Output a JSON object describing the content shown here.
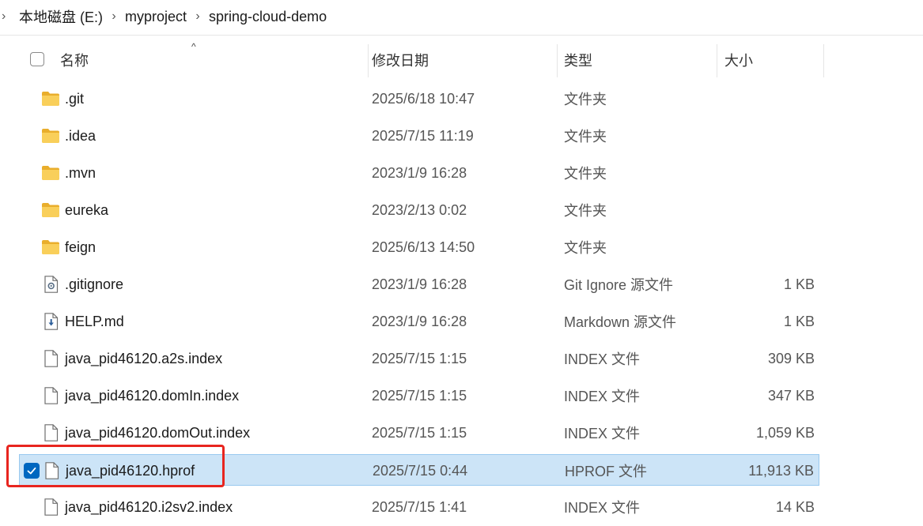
{
  "breadcrumb": {
    "items": [
      {
        "label": "本地磁盘 (E:)"
      },
      {
        "label": "myproject"
      },
      {
        "label": "spring-cloud-demo"
      }
    ]
  },
  "columns": {
    "name": "名称",
    "date": "修改日期",
    "type": "类型",
    "size": "大小"
  },
  "colors": {
    "selected_bg": "#cce4f7",
    "accent": "#0067c0",
    "highlight": "#e8251f",
    "folder": "#f7c64a"
  },
  "files": [
    {
      "name": ".git",
      "date": "2025/6/18 10:47",
      "type": "文件夹",
      "size": "",
      "icon": "folder-icon"
    },
    {
      "name": ".idea",
      "date": "2025/7/15 11:19",
      "type": "文件夹",
      "size": "",
      "icon": "folder-icon"
    },
    {
      "name": ".mvn",
      "date": "2023/1/9 16:28",
      "type": "文件夹",
      "size": "",
      "icon": "folder-icon"
    },
    {
      "name": "eureka",
      "date": "2023/2/13 0:02",
      "type": "文件夹",
      "size": "",
      "icon": "folder-icon"
    },
    {
      "name": "feign",
      "date": "2025/6/13 14:50",
      "type": "文件夹",
      "size": "",
      "icon": "folder-icon"
    },
    {
      "name": ".gitignore",
      "date": "2023/1/9 16:28",
      "type": "Git Ignore 源文件",
      "size": "1 KB",
      "icon": "settings-file-icon"
    },
    {
      "name": "HELP.md",
      "date": "2023/1/9 16:28",
      "type": "Markdown 源文件",
      "size": "1 KB",
      "icon": "markdown-file-icon"
    },
    {
      "name": "java_pid46120.a2s.index",
      "date": "2025/7/15 1:15",
      "type": "INDEX 文件",
      "size": "309 KB",
      "icon": "file-icon"
    },
    {
      "name": "java_pid46120.domIn.index",
      "date": "2025/7/15 1:15",
      "type": "INDEX 文件",
      "size": "347 KB",
      "icon": "file-icon"
    },
    {
      "name": "java_pid46120.domOut.index",
      "date": "2025/7/15 1:15",
      "type": "INDEX 文件",
      "size": "1,059 KB",
      "icon": "file-icon"
    },
    {
      "name": "java_pid46120.hprof",
      "date": "2025/7/15 0:44",
      "type": "HPROF 文件",
      "size": "11,913 KB",
      "icon": "file-icon",
      "selected": true
    },
    {
      "name": "java_pid46120.i2sv2.index",
      "date": "2025/7/15 1:41",
      "type": "INDEX 文件",
      "size": "14 KB",
      "icon": "file-icon"
    }
  ]
}
